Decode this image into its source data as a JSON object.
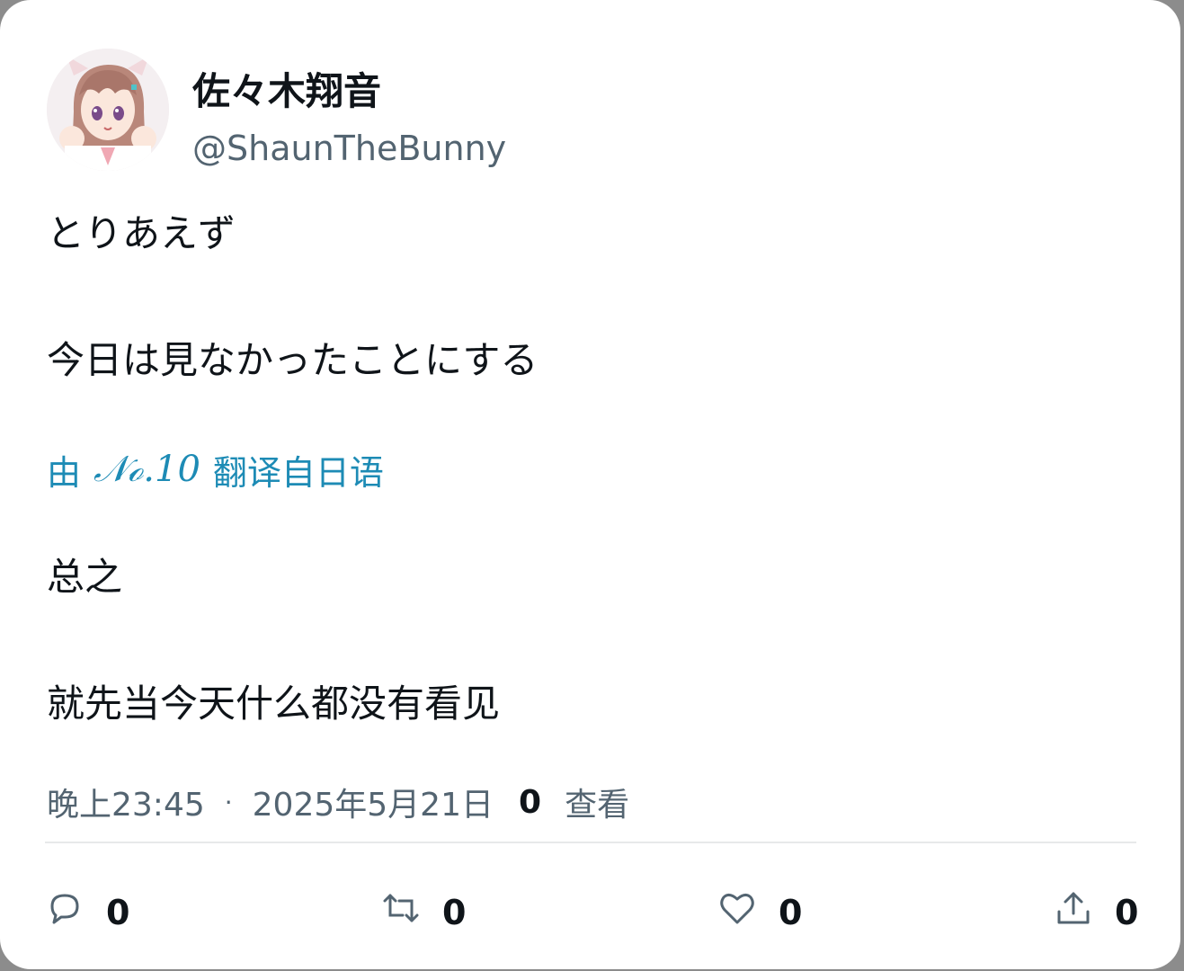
{
  "author": {
    "display_name": "佐々木翔音",
    "handle": "@ShaunTheBunny",
    "avatar": "avatar-anime-girl"
  },
  "post": {
    "lines": [
      "とりあえず",
      "今日は見なかったことにする"
    ]
  },
  "translation": {
    "by": "由",
    "engine": "𝒩ℴ.10",
    "label": "翻译自日语",
    "lines": [
      "总之",
      "就先当今天什么都没有看见"
    ]
  },
  "meta": {
    "time": "晚上23:45",
    "separator": "·",
    "date": "2025年5月21日",
    "views_count": "0",
    "views_label": "查看"
  },
  "actions": {
    "reply": {
      "icon": "reply-icon",
      "count": "0"
    },
    "repost": {
      "icon": "repost-icon",
      "count": "0"
    },
    "like": {
      "icon": "heart-icon",
      "count": "0"
    },
    "share": {
      "icon": "share-icon",
      "count": "0"
    }
  },
  "colors": {
    "link": "#1d8bb5",
    "text": "#0f1419",
    "muted": "#536471"
  }
}
